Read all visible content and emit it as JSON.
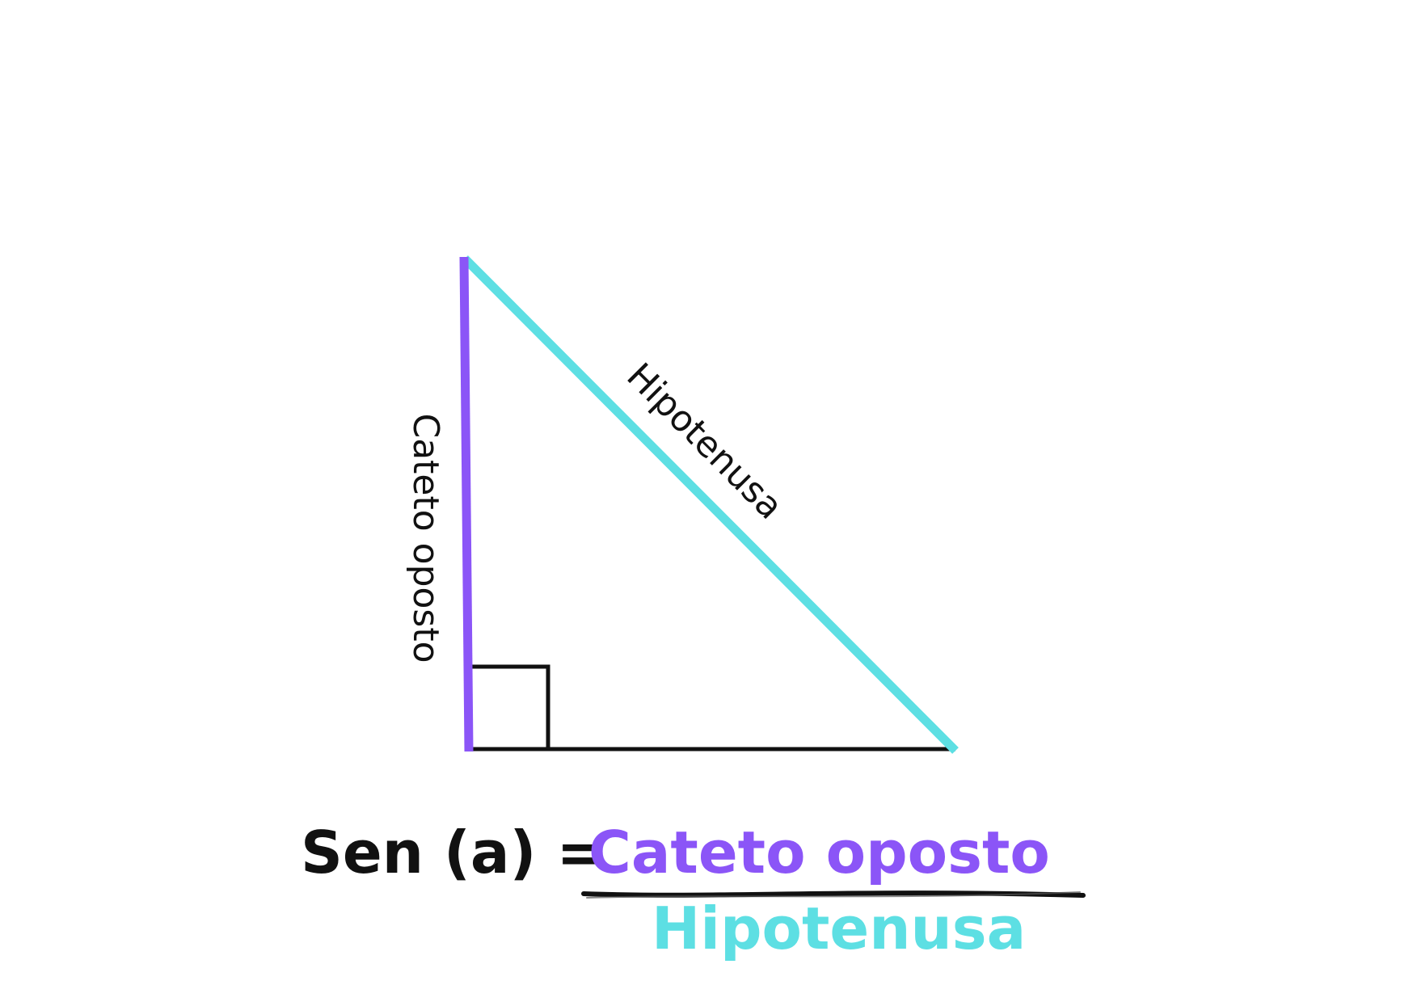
{
  "diagram": {
    "labels": {
      "opposite_side": "Cateto oposto",
      "hypotenuse": "Hipotenusa"
    },
    "formula": {
      "lhs": "Sen (a) =",
      "numerator": "Cateto oposto",
      "denominator": "Hipotenusa"
    },
    "colors": {
      "opposite_side": "#8b55f7",
      "hypotenuse": "#5ddfe3",
      "adjacent_side": "#111111",
      "text": "#111111"
    }
  }
}
